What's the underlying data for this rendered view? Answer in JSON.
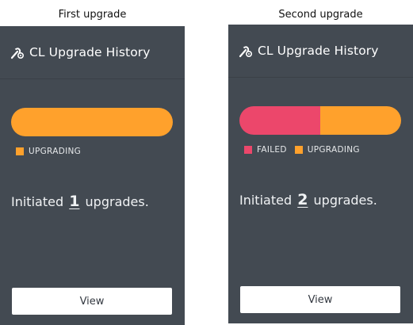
{
  "colors": {
    "panel_background": "#434a52",
    "failed": "#ec476b",
    "upgrading": "#ffa12c"
  },
  "panels": [
    {
      "caption": "First upgrade",
      "icon": "wrench-gear-icon",
      "title": "CL Upgrade History",
      "status_bar": [
        {
          "status": "upgrading",
          "fraction": 1.0
        }
      ],
      "legend": [
        {
          "label": "UPGRADING",
          "color": "#ffa12c"
        }
      ],
      "summary": {
        "prefix": "Initiated",
        "count": "1",
        "suffix": "upgrades."
      },
      "button_label": "View"
    },
    {
      "caption": "Second upgrade",
      "icon": "wrench-gear-icon",
      "title": "CL Upgrade History",
      "status_bar": [
        {
          "status": "failed",
          "fraction": 0.5
        },
        {
          "status": "upgrading",
          "fraction": 0.5
        }
      ],
      "legend": [
        {
          "label": "FAILED",
          "color": "#ec476b"
        },
        {
          "label": "UPGRADING",
          "color": "#ffa12c"
        }
      ],
      "summary": {
        "prefix": "Initiated",
        "count": "2",
        "suffix": "upgrades."
      },
      "button_label": "View"
    }
  ]
}
